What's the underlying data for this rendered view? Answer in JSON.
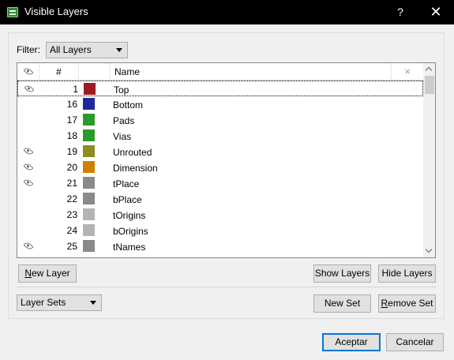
{
  "window": {
    "title": "Visible Layers",
    "help_glyph": "?",
    "close_glyph": "✕"
  },
  "filter": {
    "label": "Filter:",
    "value": "All Layers"
  },
  "table": {
    "columns": {
      "visible": "eye-icon",
      "number": "#",
      "color": "",
      "name": "Name",
      "clear": "×"
    },
    "rows": [
      {
        "visible": true,
        "number": "1",
        "color": "#9b1b22",
        "name": "Top",
        "selected": true
      },
      {
        "visible": false,
        "number": "16",
        "color": "#1f2a9a",
        "name": "Bottom"
      },
      {
        "visible": false,
        "number": "17",
        "color": "#2a9a2a",
        "name": "Pads"
      },
      {
        "visible": false,
        "number": "18",
        "color": "#2a9a2a",
        "name": "Vias"
      },
      {
        "visible": true,
        "number": "19",
        "color": "#8c8c22",
        "name": "Unrouted"
      },
      {
        "visible": true,
        "number": "20",
        "color": "#d08000",
        "name": "Dimension"
      },
      {
        "visible": true,
        "number": "21",
        "color": "#8a8a8a",
        "name": "tPlace"
      },
      {
        "visible": false,
        "number": "22",
        "color": "#8a8a8a",
        "name": "bPlace"
      },
      {
        "visible": false,
        "number": "23",
        "color": "#b4b4b4",
        "name": "tOrigins"
      },
      {
        "visible": false,
        "number": "24",
        "color": "#b4b4b4",
        "name": "bOrigins"
      },
      {
        "visible": true,
        "number": "25",
        "color": "#8a8a8a",
        "name": "tNames"
      }
    ]
  },
  "buttons": {
    "new_layer_mnemonic": "N",
    "new_layer_rest": "ew Layer",
    "show_layers": "Show Layers",
    "hide_layers": "Hide Layers",
    "new_set": "New Set",
    "remove_set_mnemonic": "R",
    "remove_set_rest": "emove Set",
    "ok": "Aceptar",
    "cancel": "Cancelar"
  },
  "layer_sets": {
    "value": "Layer Sets"
  },
  "colors": {
    "accent": "#0078d7",
    "titlebar": "#000000"
  }
}
